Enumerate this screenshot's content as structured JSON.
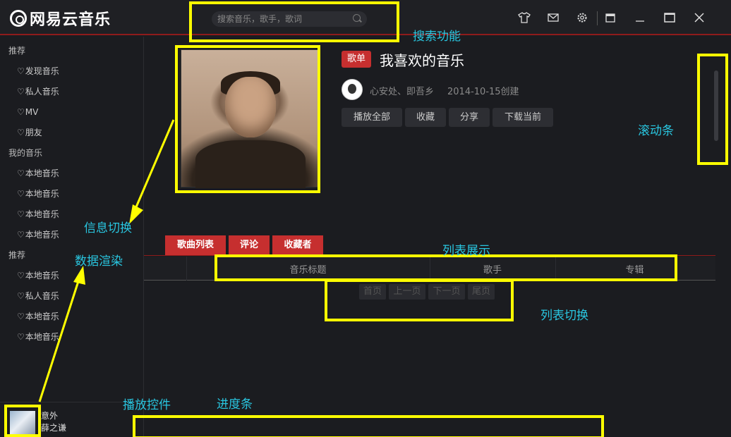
{
  "app": {
    "logo_text": "网易云音乐",
    "search_placeholder": "搜索音乐，歌手，歌词"
  },
  "window_controls": [
    "skin-icon",
    "mail-icon",
    "settings-icon",
    "mini-mode-icon",
    "minimize-icon",
    "maximize-icon",
    "close-icon"
  ],
  "sidebar": {
    "groups": [
      {
        "title": "推荐",
        "items": [
          "发现音乐",
          "私人音乐",
          "MV",
          "朋友"
        ]
      },
      {
        "title": "我的音乐",
        "items": [
          "本地音乐",
          "本地音乐",
          "本地音乐",
          "本地音乐"
        ]
      },
      {
        "title": "推荐",
        "items": [
          "本地音乐",
          "私人音乐",
          "本地音乐",
          "本地音乐"
        ]
      }
    ]
  },
  "now_playing": {
    "title": "意外",
    "artist": "薛之谦"
  },
  "playlist": {
    "badge": "歌单",
    "title": "我喜欢的音乐",
    "creator": "心安处、即吾乡",
    "created": "2014-10-15创建",
    "actions": [
      "播放全部",
      "收藏",
      "分享",
      "下载当前"
    ]
  },
  "tabs": [
    "歌曲列表",
    "评论",
    "收藏者"
  ],
  "list": {
    "columns": [
      "音乐标题",
      "歌手",
      "专辑"
    ]
  },
  "pagination": [
    "首页",
    "上一页",
    "下一页",
    "尾页"
  ],
  "annotations": {
    "search": "搜索功能",
    "scrollbar": "滚动条",
    "info_switch": "信息切换",
    "data_render": "数据渲染",
    "list_display": "列表展示",
    "list_switch": "列表切换",
    "player_controls": "播放控件",
    "progress_bar": "进度条"
  },
  "colors": {
    "accent": "#c62f2f",
    "annotation_box": "#ffff00",
    "annotation_text": "#29c6e0",
    "background": "#1b1c20"
  }
}
